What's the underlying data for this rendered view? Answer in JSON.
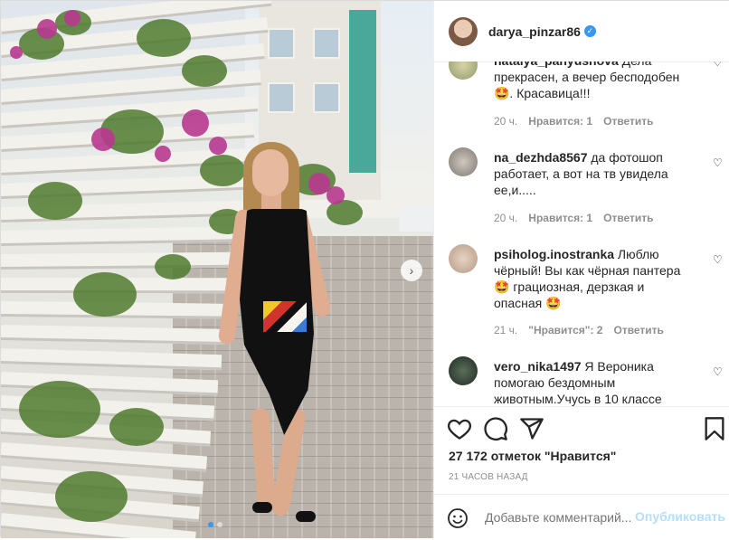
{
  "account": {
    "username": "darya_pinzar86",
    "verified_badge_icon": "verified-check-icon"
  },
  "photo": {
    "next_arrow": "›",
    "carousel_count": 2,
    "carousel_active": 1
  },
  "comments": [
    {
      "user": "natalya_panyushova",
      "text": "Дела прекрасен, а вечер бесподобен 🤩. Красавица!!!",
      "time": "20 ч.",
      "likes": "Нравится: 1",
      "reply": "Ответить"
    },
    {
      "user": "na_dezhda8567",
      "text": "да фотошоп работает, а вот на тв увидела ее,и.....",
      "time": "20 ч.",
      "likes": "Нравится: 1",
      "reply": "Ответить"
    },
    {
      "user": "psiholog.inostranka",
      "text": "Люблю чёрный! Вы как чёрная пантера 🤩 грациозная, дерзкая и опасная 🤩",
      "time": "21 ч.",
      "likes": "\"Нравится\": 2",
      "reply": "Ответить"
    },
    {
      "user": "vero_nika1497",
      "text": "Я Вероника помогаю бездомным животным.Учусь в 10 классе",
      "time": "",
      "likes": "",
      "reply": ""
    }
  ],
  "actions": {
    "like_icon": "heart-icon",
    "comment_icon": "comment-icon",
    "share_icon": "share-icon",
    "save_icon": "bookmark-icon",
    "likes_text": "27 172 отметок \"Нравится\"",
    "time_ago": "21 ЧАСОВ НАЗАД"
  },
  "add_comment": {
    "emoji_icon": "emoji-icon",
    "placeholder": "Добавьте комментарий...",
    "publish_label": "Опубликовать"
  },
  "colors": {
    "accent": "#3897f0",
    "publish_disabled": "#b2dffc",
    "text": "#262626",
    "muted": "#8e8e8e"
  }
}
